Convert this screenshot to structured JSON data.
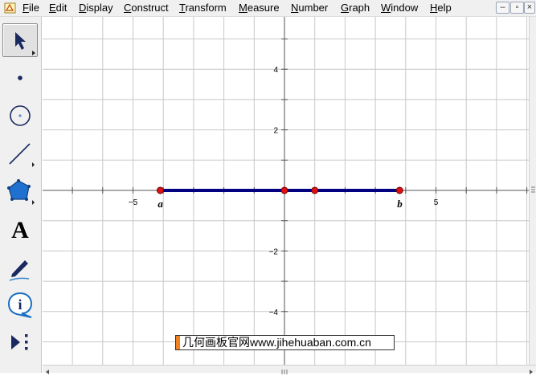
{
  "menu": {
    "items": [
      "File",
      "Edit",
      "Display",
      "Construct",
      "Transform",
      "Measure",
      "Number",
      "Graph",
      "Window",
      "Help"
    ]
  },
  "window_controls": {
    "minimize": "–",
    "restore": "▫",
    "close": "×"
  },
  "toolbox": {
    "tools": [
      {
        "name": "selection-arrow-tool",
        "icon": "arrow-icon",
        "selected": true
      },
      {
        "name": "point-tool",
        "icon": "point-icon",
        "selected": false
      },
      {
        "name": "compass-tool",
        "icon": "circle-icon",
        "selected": false
      },
      {
        "name": "straightedge-tool",
        "icon": "segment-icon",
        "selected": false
      },
      {
        "name": "polygon-tool",
        "icon": "pentagon-icon",
        "selected": false
      },
      {
        "name": "text-tool",
        "icon": "text-a-icon",
        "label": "A",
        "selected": false
      },
      {
        "name": "marker-tool",
        "icon": "pen-icon",
        "selected": false
      },
      {
        "name": "information-tool",
        "icon": "info-icon",
        "label": "i",
        "selected": false
      },
      {
        "name": "custom-tool",
        "icon": "custom-tool-icon",
        "selected": false
      }
    ]
  },
  "graph": {
    "x_range": [
      -7.5,
      8.5
    ],
    "y_range": [
      -5,
      6
    ],
    "grid_step": 1,
    "x_tick_labels": [
      {
        "value": -5,
        "text": "−5"
      },
      {
        "value": 5,
        "text": "5"
      }
    ],
    "y_tick_labels": [
      {
        "value": 4,
        "text": "4"
      },
      {
        "value": 2,
        "text": "2"
      },
      {
        "value": -2,
        "text": "−2"
      },
      {
        "value": -4,
        "text": "−4"
      }
    ],
    "segment": {
      "from": -4.1,
      "to": 3.8,
      "color": "#000080"
    },
    "points": [
      {
        "x": -4.1,
        "y": 0,
        "label": "a"
      },
      {
        "x": 0,
        "y": 0,
        "label": ""
      },
      {
        "x": 1,
        "y": 0,
        "label": ""
      },
      {
        "x": 3.8,
        "y": 0,
        "label": "b"
      }
    ],
    "colors": {
      "grid": "#c8c8c8",
      "axis": "#555555",
      "point_fill": "#e01010",
      "segment": "#000080"
    }
  },
  "watermark": {
    "text": "几何画板官网www.jihehuaban.com.cn"
  }
}
